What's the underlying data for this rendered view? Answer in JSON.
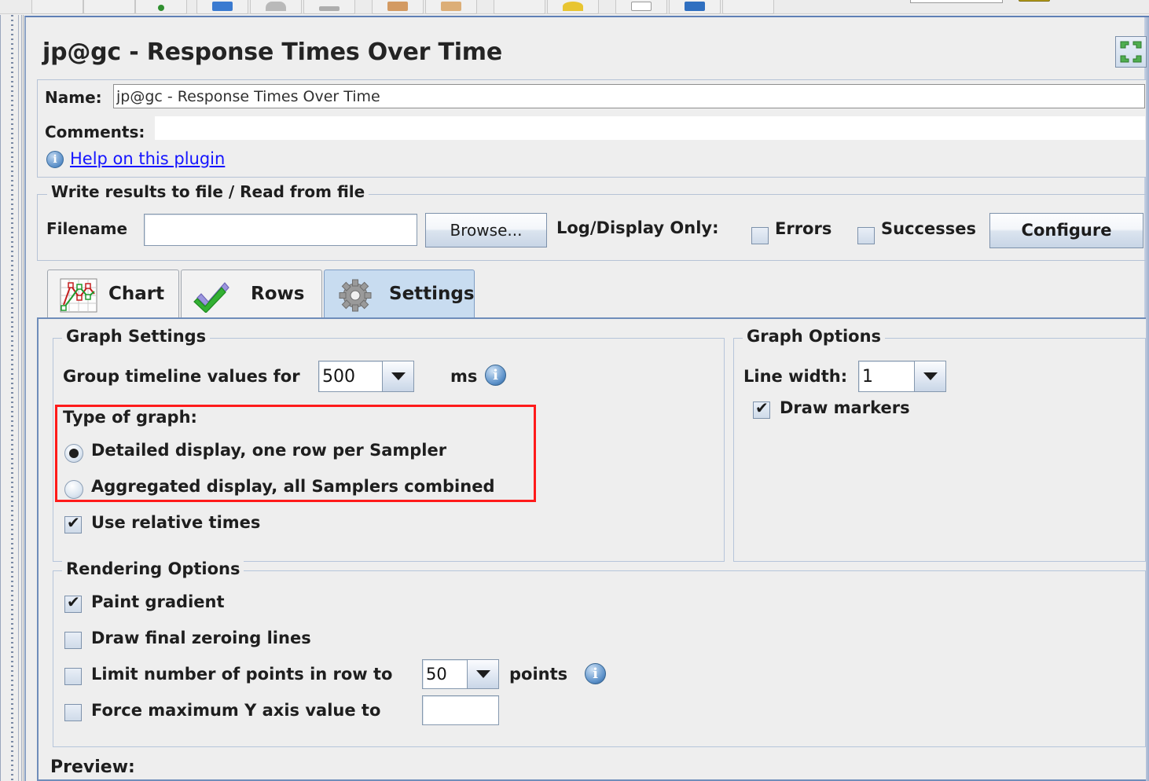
{
  "window": {
    "title": "jp@gc - Response Times Over Time",
    "maximize_icon": "expand-arrows-icon"
  },
  "name_field": {
    "label": "Name:",
    "value": "jp@gc - Response Times Over Time"
  },
  "comments_field": {
    "label": "Comments:",
    "value": "",
    "placeholder": ""
  },
  "help": {
    "icon": "info-icon",
    "link_text": "Help on this plugin"
  },
  "write_results": {
    "legend": "Write results to file / Read from file",
    "filename_label": "Filename",
    "filename_value": "",
    "browse_label": "Browse...",
    "log_display_label": "Log/Display Only:",
    "errors_label": "Errors",
    "errors_checked": false,
    "successes_label": "Successes",
    "successes_checked": false,
    "configure_label": "Configure"
  },
  "tabs": [
    {
      "label": "Chart",
      "icon": "line-chart-icon",
      "selected": false
    },
    {
      "label": "Rows",
      "icon": "double-checkmark-icon",
      "selected": false
    },
    {
      "label": "Settings",
      "icon": "gear-icon",
      "selected": true
    }
  ],
  "graph_settings": {
    "legend": "Graph Settings",
    "group_timeline_label": "Group timeline values for",
    "group_timeline_value": "500",
    "group_timeline_unit": "ms",
    "group_timeline_info_icon": "info-icon",
    "type_of_graph_label": "Type of graph:",
    "radio_detailed_label": "Detailed display, one row per Sampler",
    "radio_detailed_selected": true,
    "radio_aggregated_label": "Aggregated display, all Samplers combined",
    "radio_aggregated_selected": false,
    "use_relative_times_label": "Use relative times",
    "use_relative_times_checked": true,
    "highlight_color": "#ff1a1a"
  },
  "graph_options": {
    "legend": "Graph Options",
    "line_width_label": "Line width:",
    "line_width_value": "1",
    "draw_markers_label": "Draw markers",
    "draw_markers_checked": true
  },
  "rendering_options": {
    "legend": "Rendering Options",
    "paint_gradient_label": "Paint gradient",
    "paint_gradient_checked": true,
    "draw_final_zeroing_label": "Draw final zeroing lines",
    "draw_final_zeroing_checked": false,
    "limit_points_label": "Limit number of points in row to",
    "limit_points_checked": false,
    "limit_points_value": "50",
    "limit_points_suffix": "points",
    "limit_points_info_icon": "info-icon",
    "force_max_y_label": "Force maximum Y axis value to",
    "force_max_y_checked": false,
    "force_max_y_value": ""
  },
  "preview": {
    "label": "Preview:"
  }
}
